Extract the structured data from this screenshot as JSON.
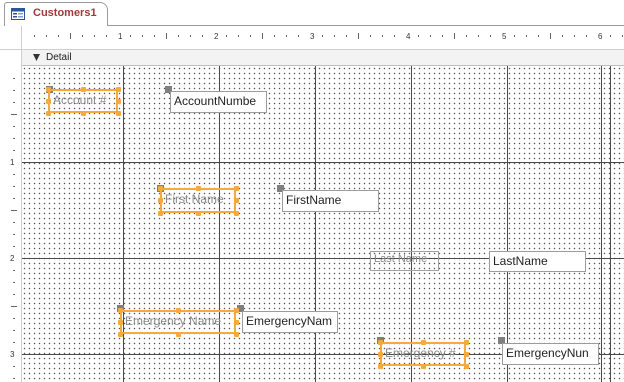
{
  "tab": {
    "label": "Customers1",
    "icon": "form-icon"
  },
  "section": {
    "label": "Detail"
  },
  "ruler": {
    "horizontal": [
      "1",
      "2",
      "3",
      "4",
      "5",
      "6"
    ],
    "vertical": [
      "1",
      "2",
      "3"
    ]
  },
  "controls": {
    "account_label": "Account #",
    "account_textbox": "AccountNumbe",
    "firstname_label": "First Name",
    "firstname_textbox": "FirstName",
    "lastname_label": "Last Name",
    "lastname_textbox": "LastName",
    "emergencyname_label": "Emergency Name",
    "emergencyname_textbox": "EmergencyNam",
    "emergencynum_label": "Emergency #",
    "emergencynum_textbox": "EmergencyNun"
  },
  "colors": {
    "selection": "#f7a93b",
    "tab_text": "#a4373a",
    "grid_line": "#4b4b4b"
  }
}
